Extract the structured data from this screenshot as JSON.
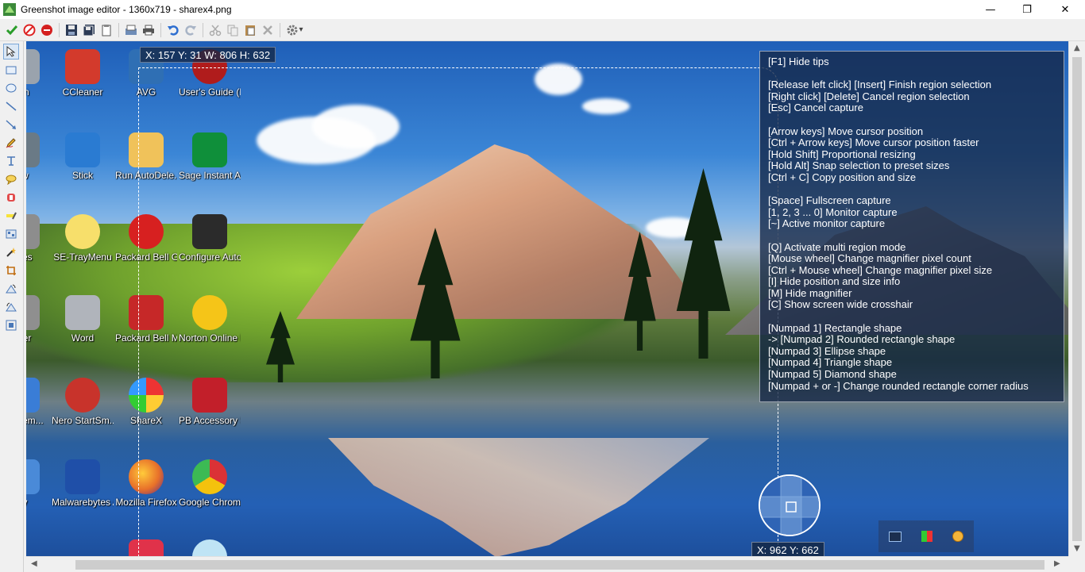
{
  "window": {
    "title": "Greenshot image editor - 1360x719 - sharex4.png",
    "minimize_glyph": "—",
    "maximize_glyph": "❐",
    "close_glyph": "✕"
  },
  "toolbar": {
    "icons": [
      "check-icon",
      "cancel-icon",
      "stop-icon",
      "save-icon",
      "save-as-icon",
      "copy-clipboard-icon",
      "email-icon",
      "print-icon",
      "undo-icon",
      "redo-icon",
      "cut-icon",
      "copy-icon",
      "paste-icon",
      "delete-icon",
      "settings-icon"
    ],
    "settings_dropdown_glyph": "▾"
  },
  "tools": [
    "cursor",
    "rectangle",
    "ellipse",
    "line",
    "arrow",
    "freehand",
    "text",
    "speechbubble",
    "counter",
    "highlight",
    "obfuscate",
    "effects",
    "crop",
    "rotate-cw",
    "rotate-ccw",
    "resize"
  ],
  "capture": {
    "position_info": "X: 157 Y: 31 W: 806 H: 632",
    "cursor_info": "X: 962 Y: 662",
    "tips": [
      "[F1] Hide tips",
      "",
      "[Release left click] [Insert] Finish region selection",
      "[Right click] [Delete] Cancel region selection",
      "[Esc] Cancel capture",
      "",
      "[Arrow keys] Move cursor position",
      "[Ctrl + Arrow keys] Move cursor position faster",
      "[Hold Shift] Proportional resizing",
      "[Hold Alt] Snap selection to preset sizes",
      "[Ctrl + C] Copy position and size",
      "",
      "[Space] Fullscreen capture",
      "[1, 2, 3 ... 0] Monitor capture",
      "[~] Active monitor capture",
      "",
      "[Q] Activate multi region mode",
      "[Mouse wheel] Change magnifier pixel count",
      "[Ctrl + Mouse wheel] Change magnifier pixel size",
      "[I] Hide position and size info",
      "[M] Hide magnifier",
      "[C] Show screen wide crosshair",
      "",
      "[Numpad 1] Rectangle shape",
      "-> [Numpad 2] Rounded rectangle shape",
      "[Numpad 3] Ellipse shape",
      "[Numpad 4] Triangle shape",
      "[Numpad 5] Diamond shape",
      "[Numpad + or -] Change rounded rectangle corner radius"
    ]
  },
  "desktop_icons": [
    {
      "label": "Bin",
      "color": "#9aa3ad"
    },
    {
      "label": "CCleaner",
      "color": "#d33a2c"
    },
    {
      "label": "AVG",
      "color": "#2f6fb4"
    },
    {
      "label": "User's Guide (Packard B...",
      "color": "#b01c1c"
    },
    {
      "label": "ew",
      "color": "#6a7a86"
    },
    {
      "label": "Stick",
      "color": "#2a7bd2"
    },
    {
      "label": "Run AutoDele...",
      "color": "#f0c25a"
    },
    {
      "label": "Sage Instant Accounts ...",
      "color": "#0f8f3a"
    },
    {
      "label": "Files",
      "color": "#8d8d8d"
    },
    {
      "label": "SE-TrayMenu",
      "color": "#f7df6b"
    },
    {
      "label": "Packard Bell Games",
      "color": "#d72020"
    },
    {
      "label": "Configure AutoDelete",
      "color": "#2b2b2b"
    },
    {
      "label": "aller",
      "color": "#8f8f8f"
    },
    {
      "label": "Word",
      "color": "#b0b4bb"
    },
    {
      "label": "Packard Bell MyBackup",
      "color": "#c62828"
    },
    {
      "label": "Norton Online Backup",
      "color": "#f5c518"
    },
    {
      "label": "ntrol em...",
      "color": "#3a7dd6"
    },
    {
      "label": "Nero StartSm...",
      "color": "#c8332b"
    },
    {
      "label": "ShareX",
      "color": "#2d8fe0"
    },
    {
      "label": "PB Accessory Store",
      "color": "#c21f2a"
    },
    {
      "label": "hy",
      "color": "#4a8ad8"
    },
    {
      "label": "Malwarebytes Anti-Malware",
      "color": "#1f4fa8"
    },
    {
      "label": "Mozilla Firefox",
      "color": "#e8702a"
    },
    {
      "label": "Google Chrome",
      "color": "#3c8d3f"
    }
  ]
}
